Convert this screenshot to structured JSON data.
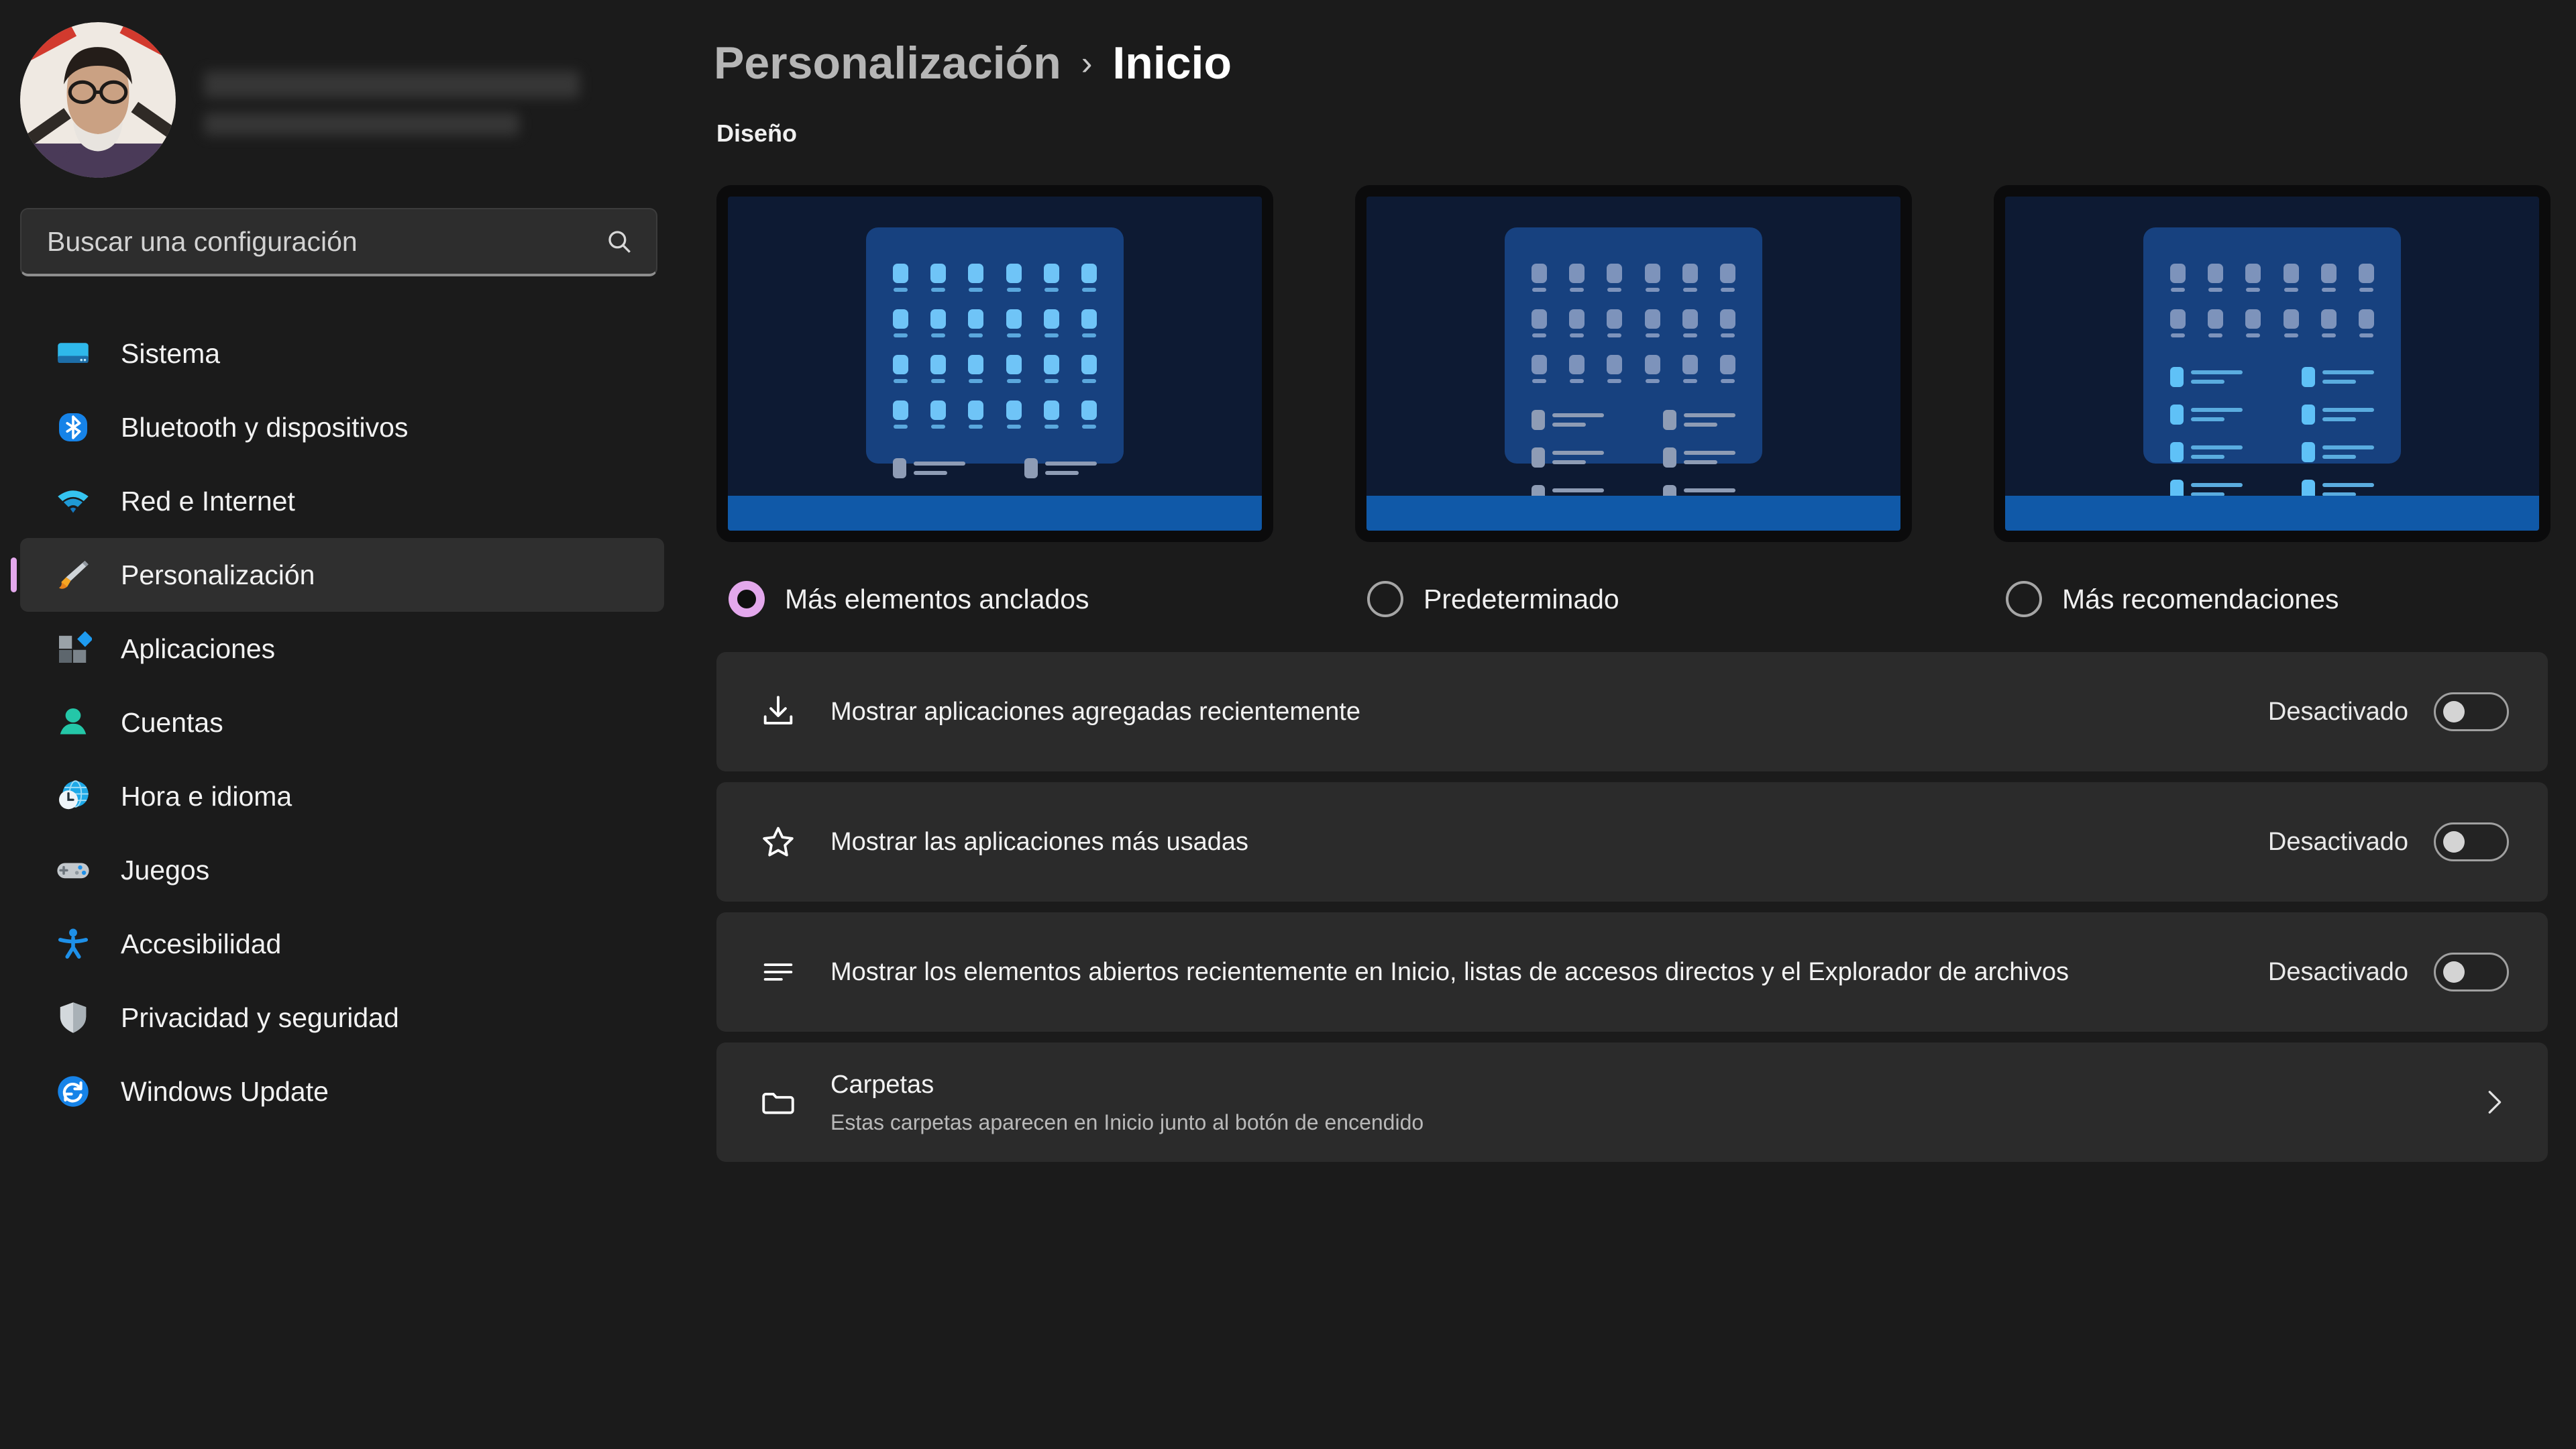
{
  "sidebar": {
    "profile": {
      "name_redacted": true,
      "email_redacted": true
    },
    "search": {
      "placeholder": "Buscar una configuración",
      "value": "",
      "icon": "search-icon"
    },
    "items": [
      {
        "label": "Sistema",
        "icon": "monitor-icon",
        "selected": false
      },
      {
        "label": "Bluetooth y dispositivos",
        "icon": "bluetooth-icon",
        "selected": false
      },
      {
        "label": "Red e Internet",
        "icon": "wifi-icon",
        "selected": false
      },
      {
        "label": "Personalización",
        "icon": "paintbrush-icon",
        "selected": true
      },
      {
        "label": "Aplicaciones",
        "icon": "apps-blocks-icon",
        "selected": false
      },
      {
        "label": "Cuentas",
        "icon": "person-icon",
        "selected": false
      },
      {
        "label": "Hora e idioma",
        "icon": "globe-clock-icon",
        "selected": false
      },
      {
        "label": "Juegos",
        "icon": "gamepad-icon",
        "selected": false
      },
      {
        "label": "Accesibilidad",
        "icon": "accessibility-icon",
        "selected": false
      },
      {
        "label": "Privacidad y seguridad",
        "icon": "shield-icon",
        "selected": false
      },
      {
        "label": "Windows Update",
        "icon": "refresh-icon",
        "selected": false
      }
    ]
  },
  "header": {
    "breadcrumb_parent": "Personalización",
    "breadcrumb_separator": "›",
    "breadcrumb_current": "Inicio"
  },
  "main": {
    "section_title": "Diseño",
    "layout_options": [
      {
        "label": "Más elementos anclados",
        "selected": true,
        "pin_rows": 4,
        "rec_rows": 1,
        "emphasis": "pins"
      },
      {
        "label": "Predeterminado",
        "selected": false,
        "pin_rows": 3,
        "rec_rows": 3,
        "emphasis": "none"
      },
      {
        "label": "Más recomendaciones",
        "selected": false,
        "pin_rows": 2,
        "rec_rows": 4,
        "emphasis": "recs"
      }
    ],
    "settings": [
      {
        "icon": "download-icon",
        "title": "Mostrar aplicaciones agregadas recientemente",
        "subtitle": "",
        "control": "toggle",
        "state_label": "Desactivado",
        "checked": false
      },
      {
        "icon": "star-icon",
        "title": "Mostrar las aplicaciones más usadas",
        "subtitle": "",
        "control": "toggle",
        "state_label": "Desactivado",
        "checked": false
      },
      {
        "icon": "list-icon",
        "title": "Mostrar los elementos abiertos recientemente en Inicio, listas de accesos directos y el Explorador de archivos",
        "subtitle": "",
        "control": "toggle",
        "state_label": "Desactivado",
        "checked": false
      },
      {
        "icon": "folder-icon",
        "title": "Carpetas",
        "subtitle": "Estas carpetas aparecen en Inicio junto al botón de encendido",
        "control": "chevron",
        "state_label": "",
        "checked": false
      }
    ]
  },
  "colors": {
    "accent": "#E3A8EC",
    "page_bg": "#1B1B1B",
    "card_bg": "#2B2B2B",
    "preview_bezel": "#0B0B0C",
    "preview_wallpaper": "#0D1A33",
    "preview_startmenu": "#17417F",
    "preview_taskbar": "#1059A8",
    "pin_bright": "#6FC4F7",
    "pin_dim": "#7D93BB",
    "text_primary": "#F2F2F2",
    "text_secondary": "#B9B9B9"
  }
}
